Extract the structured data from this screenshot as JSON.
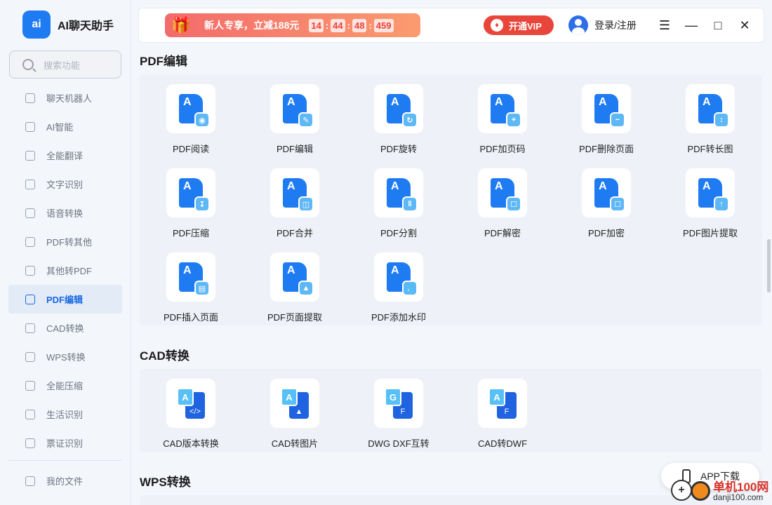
{
  "app": {
    "title": "AI聊天助手",
    "logo_text": "ai"
  },
  "search": {
    "placeholder": "搜索功能"
  },
  "sidebar": {
    "items": [
      {
        "label": "聊天机器人",
        "icon": "robot-icon"
      },
      {
        "label": "AI智能",
        "icon": "ai-icon"
      },
      {
        "label": "全能翻译",
        "icon": "translate-icon"
      },
      {
        "label": "文字识别",
        "icon": "scan-icon"
      },
      {
        "label": "语音转换",
        "icon": "voice-icon"
      },
      {
        "label": "PDF转其他",
        "icon": "pdf-convert-icon"
      },
      {
        "label": "其他转PDF",
        "icon": "to-pdf-icon"
      },
      {
        "label": "PDF编辑",
        "icon": "pdf-edit-icon",
        "active": true
      },
      {
        "label": "CAD转换",
        "icon": "cad-icon"
      },
      {
        "label": "WPS转换",
        "icon": "wps-icon"
      },
      {
        "label": "全能压缩",
        "icon": "compress-icon"
      },
      {
        "label": "生活识别",
        "icon": "camera-icon"
      },
      {
        "label": "票证识别",
        "icon": "ticket-icon"
      }
    ],
    "my_files": "我的文件"
  },
  "topbar": {
    "promo_text": "新人专享，立减188元",
    "timer": [
      "14",
      "44",
      "48",
      "459"
    ],
    "vip_label": "开通VIP",
    "login_label": "登录/注册"
  },
  "sections": {
    "pdf_edit": {
      "title": "PDF编辑",
      "tools": [
        "PDF阅读",
        "PDF编辑",
        "PDF旋转",
        "PDF加页码",
        "PDF删除页面",
        "PDF转长图",
        "PDF压缩",
        "PDF合并",
        "PDF分割",
        "PDF解密",
        "PDF加密",
        "PDF图片提取",
        "PDF插入页面",
        "PDF页面提取",
        "PDF添加水印"
      ]
    },
    "cad": {
      "title": "CAD转换",
      "tools": [
        "CAD版本转换",
        "CAD转图片",
        "DWG DXF互转",
        "CAD转DWF"
      ]
    },
    "wps": {
      "title": "WPS转换"
    }
  },
  "app_download": "APP下载",
  "watermark": {
    "text": "单机100网",
    "url": "danji100.com"
  },
  "colors": {
    "accent": "#1f7bf2",
    "active_text": "#1668e3",
    "vip": "#e8463a"
  }
}
